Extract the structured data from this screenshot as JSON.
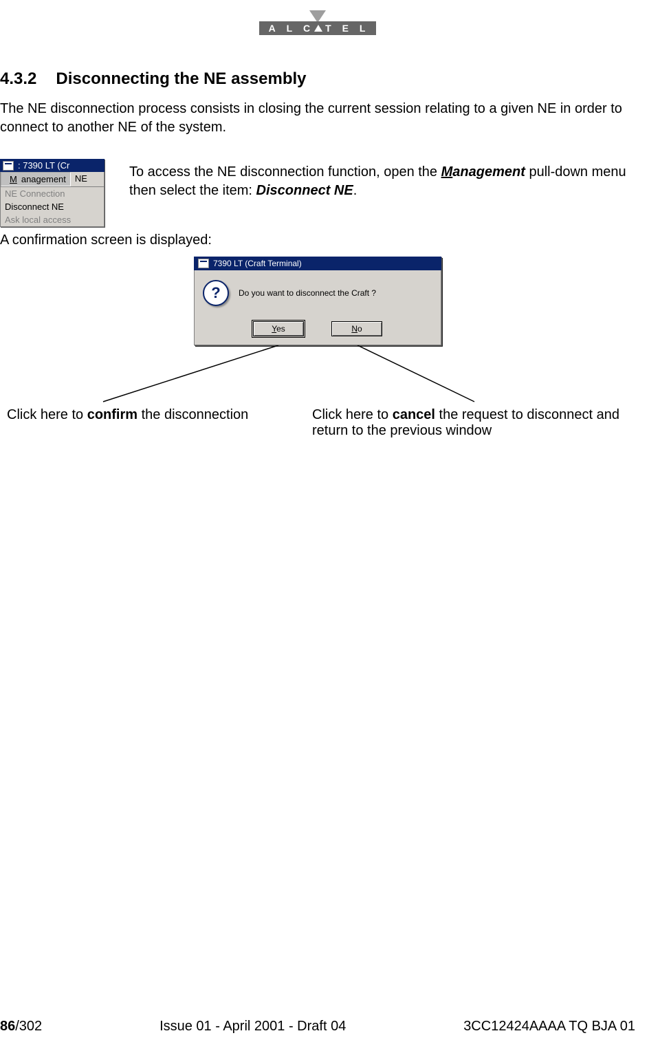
{
  "logo": {
    "text": "A L C    T E L"
  },
  "section": {
    "number": "4.3.2",
    "title": "Disconnecting the NE assembly"
  },
  "intro": "The NE disconnection process consists in closing the current session relating to a given NE in order to connect to another NE of the system.",
  "menu_shot": {
    "title": ": 7390 LT (Cr",
    "menubar_active": "Management",
    "menubar_underline": "M",
    "menubar_other": "NE",
    "items": {
      "ne_conn": "NE Connection",
      "disc": "Disconnect NE",
      "ask": "Ask local access"
    }
  },
  "menu_desc": {
    "line1a": "To access the NE disconnection function, open the ",
    "line1b_underline": "M",
    "line1b_bold": "anagement",
    "line1c": " pull-down menu then select the item: ",
    "line1d_bold": "Disconnect NE",
    "line1e": "."
  },
  "confirm_label": "A confirmation screen is displayed:",
  "dialog": {
    "title": "7390 LT (Craft Terminal)",
    "message": "Do you want to disconnect the Craft ?",
    "yes_u": "Y",
    "yes_rest": "es",
    "no_u": "N",
    "no_rest": "o"
  },
  "callouts": {
    "left_a": "Click here to ",
    "left_bold": "confirm",
    "left_b": " the disconnection",
    "right_a": "Click here to ",
    "right_bold": "cancel",
    "right_b": " the request to disconnect and return to the previous window"
  },
  "footer": {
    "page_bold": "86",
    "page_rest": "/302",
    "center": "Issue 01 - April 2001 - Draft 04",
    "right": "3CC12424AAAA TQ BJA 01"
  }
}
